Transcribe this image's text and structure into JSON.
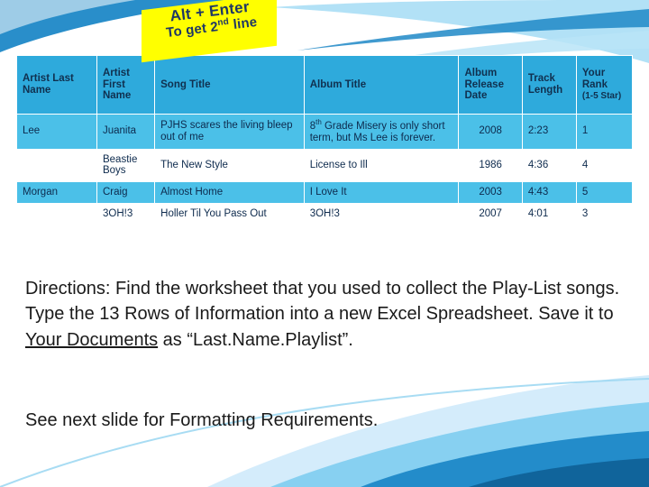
{
  "callout": {
    "line1": "Alt + Enter",
    "line2_pre": "To get 2",
    "line2_sup": "nd",
    "line2_post": " line"
  },
  "table": {
    "headers": {
      "artist_last": "Artist Last Name",
      "artist_first": "Artist First Name",
      "song_title": "Song Title",
      "album_title": "Album Title",
      "album_release": "Album Release Date",
      "track_length": "Track Length",
      "your_rank": "Your Rank",
      "your_rank_note": "(1-5 Star)"
    },
    "rows": [
      {
        "last": "Lee",
        "first": "Juanita",
        "song": "PJHS scares the living bleep out of me",
        "album_pre": "8",
        "album_sup": "th",
        "album_post": " Grade Misery is only short term, but Ms Lee is forever.",
        "release": "2008",
        "length": "2:23",
        "rank": "1"
      },
      {
        "last": "",
        "first": "Beastie Boys",
        "song": "The New Style",
        "album": "License to Ill",
        "release": "1986",
        "length": "4:36",
        "rank": "4"
      },
      {
        "last": "Morgan",
        "first": "Craig",
        "song": "Almost Home",
        "album": "I Love It",
        "release": "2003",
        "length": "4:43",
        "rank": "5"
      },
      {
        "last": "",
        "first": "3OH!3",
        "song": "Holler Til You Pass Out",
        "album": "3OH!3",
        "release": "2007",
        "length": "4:01",
        "rank": "3"
      }
    ]
  },
  "body": {
    "directions_part1": "Directions: Find the worksheet that you used to collect the Play-List songs. Type the 13 Rows of Information into a new Excel Spreadsheet. Save it to ",
    "directions_underline": "Your Documents",
    "directions_part2": " as “Last.Name.Playlist”.",
    "next_slide": "See next slide for Formatting Requirements."
  },
  "colors": {
    "header_bg": "#2eaadc",
    "row_alt_bg": "#4bc0e8",
    "callout_bg": "#ffff00",
    "callout_text": "#1f3864",
    "swoosh_blue": "#1e88c7",
    "swoosh_light": "#9fd8f2"
  }
}
